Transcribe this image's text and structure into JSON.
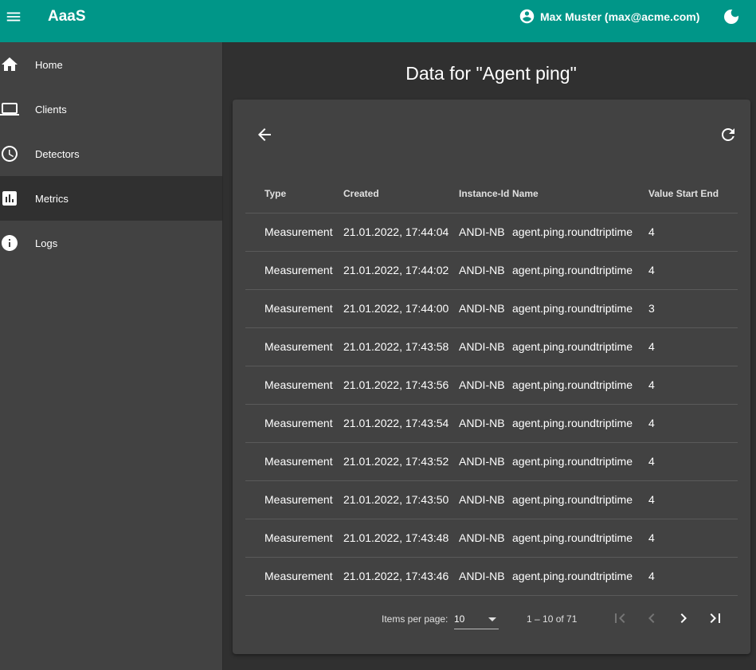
{
  "app": {
    "title": "AaaS"
  },
  "user": {
    "display": "Max Muster (max@acme.com)"
  },
  "sidebar": {
    "items": [
      {
        "label": "Home",
        "icon": "home-icon"
      },
      {
        "label": "Clients",
        "icon": "laptop-icon"
      },
      {
        "label": "Detectors",
        "icon": "clock-icon"
      },
      {
        "label": "Metrics",
        "icon": "bar-chart-icon",
        "active": true
      },
      {
        "label": "Logs",
        "icon": "info-icon"
      }
    ]
  },
  "page": {
    "title": "Data for \"Agent ping\""
  },
  "table": {
    "headers": {
      "type": "Type",
      "created": "Created",
      "instance": "Instance-Id",
      "name": "Name",
      "value": "Value Start End"
    },
    "rows": [
      {
        "type": "Measurement",
        "created": "21.01.2022, 17:44:04",
        "instance": "ANDI-NB",
        "name": "agent.ping.roundtriptime",
        "value": "4"
      },
      {
        "type": "Measurement",
        "created": "21.01.2022, 17:44:02",
        "instance": "ANDI-NB",
        "name": "agent.ping.roundtriptime",
        "value": "4"
      },
      {
        "type": "Measurement",
        "created": "21.01.2022, 17:44:00",
        "instance": "ANDI-NB",
        "name": "agent.ping.roundtriptime",
        "value": "3"
      },
      {
        "type": "Measurement",
        "created": "21.01.2022, 17:43:58",
        "instance": "ANDI-NB",
        "name": "agent.ping.roundtriptime",
        "value": "4"
      },
      {
        "type": "Measurement",
        "created": "21.01.2022, 17:43:56",
        "instance": "ANDI-NB",
        "name": "agent.ping.roundtriptime",
        "value": "4"
      },
      {
        "type": "Measurement",
        "created": "21.01.2022, 17:43:54",
        "instance": "ANDI-NB",
        "name": "agent.ping.roundtriptime",
        "value": "4"
      },
      {
        "type": "Measurement",
        "created": "21.01.2022, 17:43:52",
        "instance": "ANDI-NB",
        "name": "agent.ping.roundtriptime",
        "value": "4"
      },
      {
        "type": "Measurement",
        "created": "21.01.2022, 17:43:50",
        "instance": "ANDI-NB",
        "name": "agent.ping.roundtriptime",
        "value": "4"
      },
      {
        "type": "Measurement",
        "created": "21.01.2022, 17:43:48",
        "instance": "ANDI-NB",
        "name": "agent.ping.roundtriptime",
        "value": "4"
      },
      {
        "type": "Measurement",
        "created": "21.01.2022, 17:43:46",
        "instance": "ANDI-NB",
        "name": "agent.ping.roundtriptime",
        "value": "4"
      }
    ]
  },
  "paginator": {
    "items_per_page_label": "Items per page:",
    "items_per_page": "10",
    "range": "1 – 10 of 71"
  },
  "colors": {
    "toolbar": "#009688",
    "sidebar": "#424242",
    "background": "#303030",
    "card": "#424242"
  }
}
